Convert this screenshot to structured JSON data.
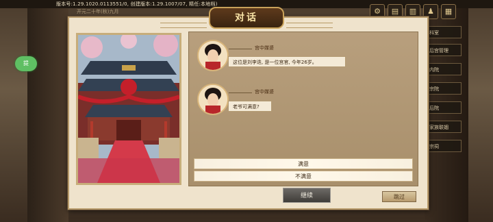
{
  "header": {
    "version_text": "版本号:1.29.1020.0113551/0, 创建版本:1.29.1007/07, 精任:本地档)",
    "sub_text": "开元二十年(秋)九月"
  },
  "top_icons": [
    {
      "icon": "settings-icon",
      "label": "⚙"
    },
    {
      "icon": "bag-icon",
      "label": "▤"
    },
    {
      "icon": "map-icon",
      "label": "▥"
    },
    {
      "icon": "person-icon",
      "label": "♟"
    },
    {
      "icon": "book-icon",
      "label": "▦"
    }
  ],
  "side_menu": [
    "科室",
    "后宫管理",
    "内院",
    "宗院",
    "后院",
    "家族联姻",
    "宗祠"
  ],
  "hint_label": "提",
  "dialog": {
    "title": "对话",
    "messages": [
      {
        "speaker": "宫中媒婆",
        "text": "这位是刘李迭, 是一位宫官, 今年26岁。"
      },
      {
        "speaker": "宫中媒婆",
        "text": "老爷可满意?"
      }
    ],
    "choices": [
      "满意",
      "不满意"
    ],
    "continue_label": "继续",
    "skip_label": "跳过"
  },
  "colors": {
    "panel_bg": "#efe3cc",
    "talk_bg": "#b89f7d",
    "title_plaque": "#4a2e14"
  }
}
